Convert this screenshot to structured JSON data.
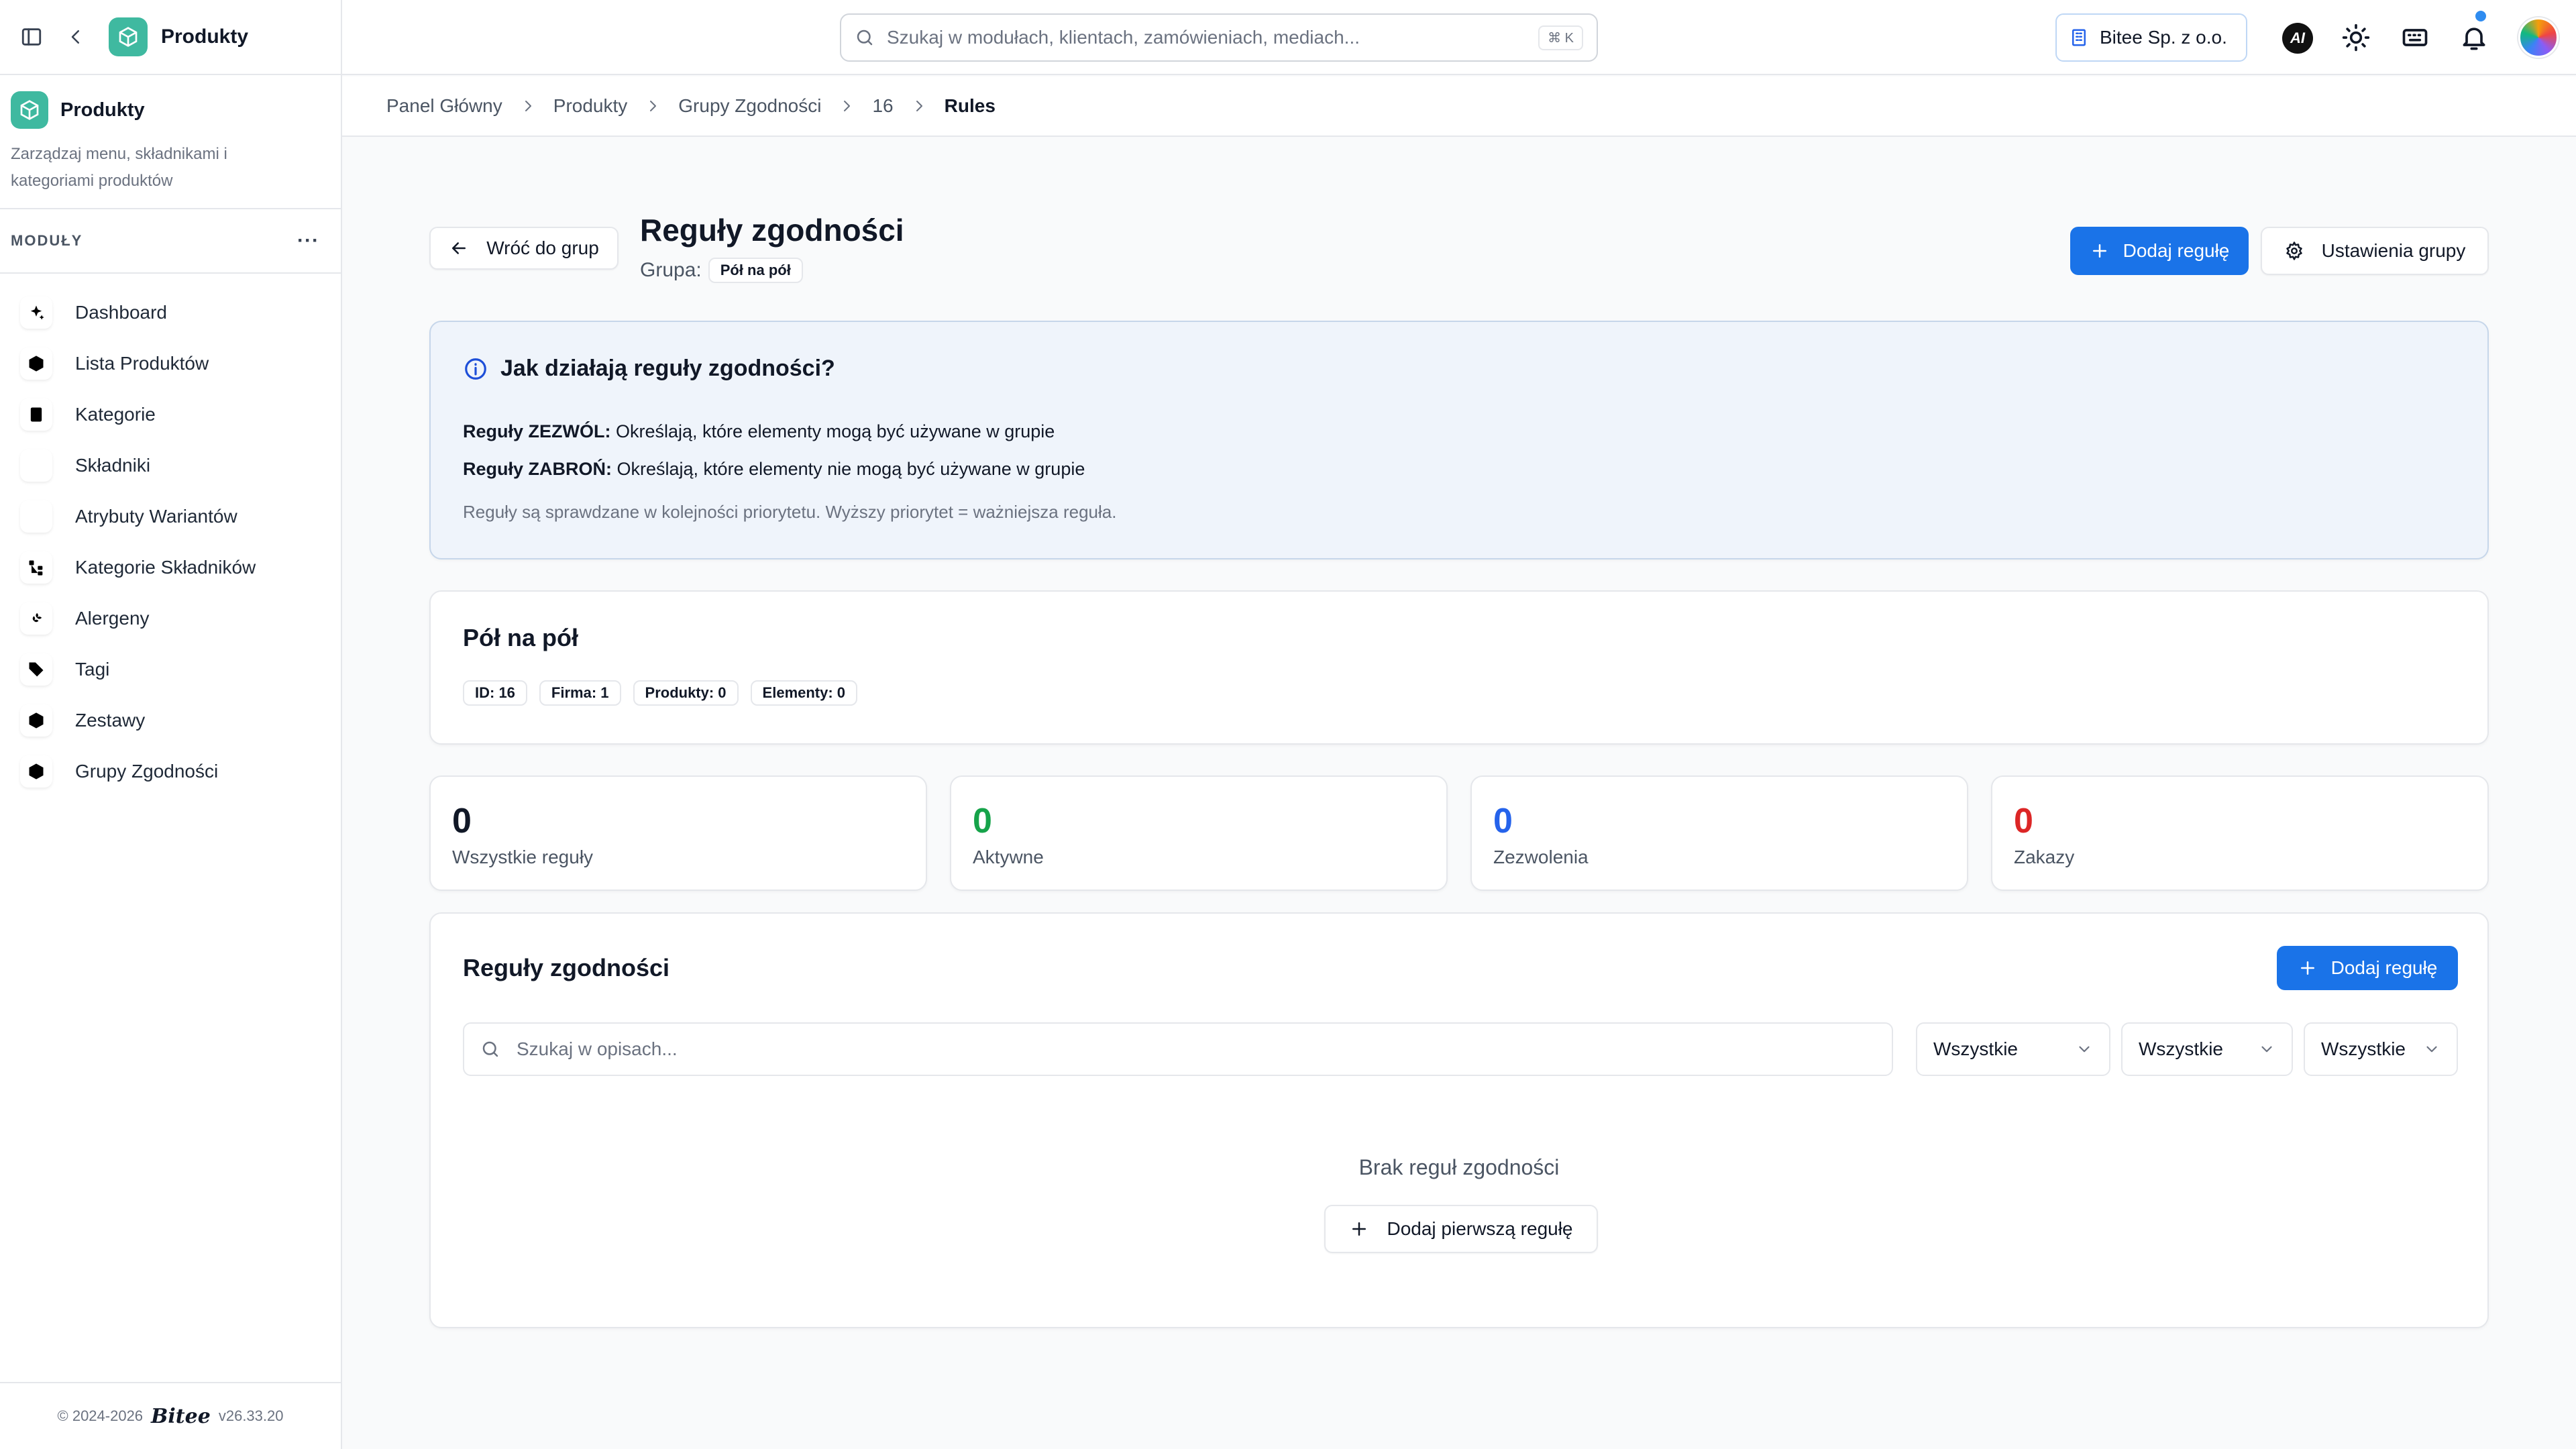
{
  "app": {
    "title": "Produkty"
  },
  "sidebar": {
    "module_name": "Produkty",
    "module_desc": "Zarządzaj menu, składnikami i kategoriami produktów",
    "section_label": "MODUŁY",
    "section_menu": "···",
    "items": [
      {
        "label": "Dashboard",
        "icon": "sparkles-icon"
      },
      {
        "label": "Lista Produktów",
        "icon": "box-icon"
      },
      {
        "label": "Kategorie",
        "icon": "document-icon"
      },
      {
        "label": "Składniki",
        "icon": "utensils-crossed-icon"
      },
      {
        "label": "Atrybuty Wariantów",
        "icon": "sliders-icon"
      },
      {
        "label": "Kategorie Składników",
        "icon": "tree-icon"
      },
      {
        "label": "Alergeny",
        "icon": "wheat-icon"
      },
      {
        "label": "Tagi",
        "icon": "tag-icon"
      },
      {
        "label": "Zestawy",
        "icon": "box-icon"
      },
      {
        "label": "Grupy Zgodności",
        "icon": "box-icon"
      }
    ],
    "footer_copyright": "© 2024-2026",
    "footer_brand": "Bitee",
    "footer_version": "v26.33.20"
  },
  "header": {
    "search_placeholder": "Szukaj w modułach, klientach, zamówieniach, mediach...",
    "search_shortcut": "⌘ K",
    "company": "Bitee Sp. z o.o.",
    "ai_label": "AI"
  },
  "breadcrumb": [
    "Panel Główny",
    "Produkty",
    "Grupy Zgodności",
    "16"
  ],
  "breadcrumb_current": "Rules",
  "page": {
    "back_label": "Wróć do grup",
    "title": "Reguły zgodności",
    "group_label": "Grupa:",
    "group_value": "Pół na pół",
    "add_rule_label": "Dodaj regułę",
    "settings_label": "Ustawienia grupy"
  },
  "info": {
    "title": "Jak działają reguły zgodności?",
    "allow_label": "Reguły ZEZWÓL:",
    "allow_text": "Określają, które elementy mogą być używane w grupie",
    "deny_label": "Reguły ZABROŃ:",
    "deny_text": "Określają, które elementy nie mogą być używane w grupie",
    "note": "Reguły są sprawdzane w kolejności priorytetu. Wyższy priorytet = ważniejsza reguła."
  },
  "group": {
    "name": "Pół na pół",
    "chips": [
      "ID: 16",
      "Firma: 1",
      "Produkty: 0",
      "Elementy: 0"
    ]
  },
  "stats": [
    {
      "value": "0",
      "label": "Wszystkie reguły",
      "color": "#111827"
    },
    {
      "value": "0",
      "label": "Aktywne",
      "color": "#16a34a"
    },
    {
      "value": "0",
      "label": "Zezwolenia",
      "color": "#2563eb"
    },
    {
      "value": "0",
      "label": "Zakazy",
      "color": "#dc2626"
    }
  ],
  "rules": {
    "title": "Reguły zgodności",
    "add_label": "Dodaj regułę",
    "search_placeholder": "Szukaj w opisach...",
    "filters": [
      "Wszystkie",
      "Wszystkie",
      "Wszystkie"
    ],
    "empty_text": "Brak reguł zgodności",
    "add_first_label": "Dodaj pierwszą regułę"
  },
  "colors": {
    "accent": "#1a73e8",
    "brand": "#3fb9a0"
  }
}
